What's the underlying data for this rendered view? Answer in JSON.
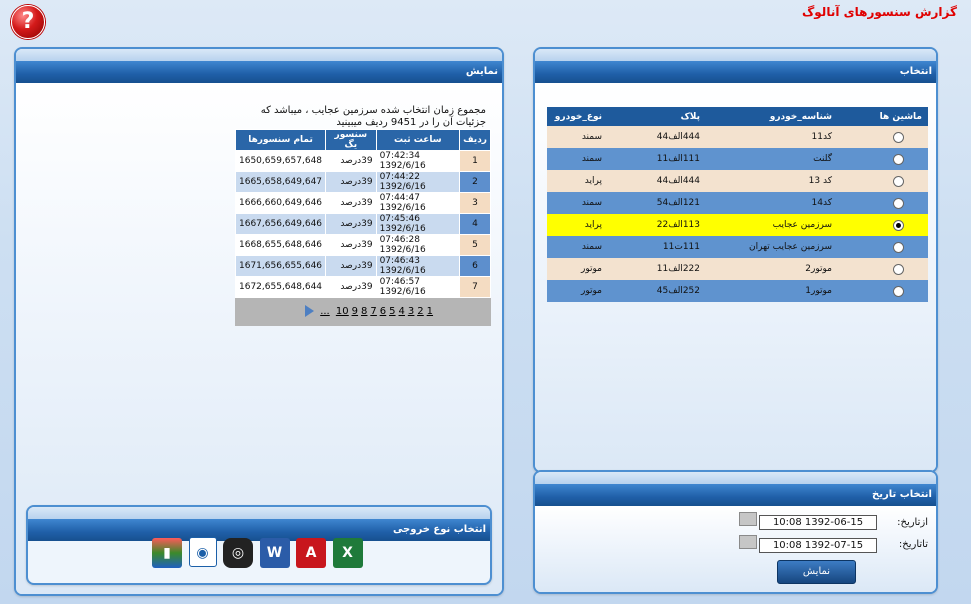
{
  "page": {
    "title": "گزارش سنسورهای آنالوگ"
  },
  "help": {
    "label": "?"
  },
  "selection": {
    "title": "انتخاب",
    "headers": [
      "ماشین ها",
      "شناسه_خودرو",
      "پلاک",
      "نوع_خودرو"
    ],
    "rows": [
      {
        "name": "کد11",
        "plate": "444الف44",
        "type": "سمند",
        "selected": false
      },
      {
        "name": "گلنت",
        "plate": "111الف11",
        "type": "سمند",
        "selected": false
      },
      {
        "name": "کد 13",
        "plate": "444الف44",
        "type": "پراید",
        "selected": false
      },
      {
        "name": "کد14",
        "plate": "121الف54",
        "type": "سمند",
        "selected": false
      },
      {
        "name": "سرزمین عجایب",
        "plate": "113الف22",
        "type": "پراید",
        "selected": true
      },
      {
        "name": "سرزمین عجایب تهران",
        "plate": "111ت11",
        "type": "سمند",
        "selected": false
      },
      {
        "name": "موتور2",
        "plate": "222الف11",
        "type": "موتور",
        "selected": false
      },
      {
        "name": "موتور1",
        "plate": "252الف45",
        "type": "موتور",
        "selected": false
      }
    ]
  },
  "date_select": {
    "title": "انتخاب تاریخ",
    "from_label": "ازتاریخ:",
    "from_value": "10:08 1392-06-15",
    "to_label": "تاتاریخ:",
    "to_value": "10:08 1392-07-15",
    "show_button": "نمایش"
  },
  "display": {
    "title": "نمایش",
    "summary_line1": "مجموع زمان انتخاب شده سرزمین عجایب ، میباشد که",
    "summary_line2": "جزئیات آن را در 9451 ردیف میبینید",
    "headers": [
      "ردیف",
      "ساعت ثبت",
      "سنسور یگ",
      "تمام سنسورها"
    ],
    "rows": [
      {
        "n": "1",
        "time": "07:42:34 1392/6/16",
        "sensor": "39درصد",
        "all": "1650,659,657,648"
      },
      {
        "n": "2",
        "time": "07:44:22 1392/6/16",
        "sensor": "39درصد",
        "all": "1665,658,649,647"
      },
      {
        "n": "3",
        "time": "07:44:47 1392/6/16",
        "sensor": "39درصد",
        "all": "1666,660,649,646"
      },
      {
        "n": "4",
        "time": "07:45:46 1392/6/16",
        "sensor": "39درصد",
        "all": "1667,656,649,646"
      },
      {
        "n": "5",
        "time": "07:46:28 1392/6/16",
        "sensor": "39درصد",
        "all": "1668,655,648,646"
      },
      {
        "n": "6",
        "time": "07:46:43 1392/6/16",
        "sensor": "39درصد",
        "all": "1671,656,655,646"
      },
      {
        "n": "7",
        "time": "07:46:57 1392/6/16",
        "sensor": "39درصد",
        "all": "1672,655,648,644"
      }
    ],
    "pager": {
      "ellipsis": "...",
      "pages": [
        "10",
        "9",
        "8",
        "7",
        "6",
        "5",
        "4",
        "3",
        "2",
        "1"
      ]
    }
  },
  "export": {
    "title": "انتخاب نوع خروجی",
    "icons": [
      "chart-icon",
      "browser-icon",
      "camera-icon",
      "word-icon",
      "pdf-icon",
      "excel-icon"
    ],
    "colors": {
      "excel": "#1f7a3a",
      "pdf": "#c8161d",
      "word": "#2b5ca8"
    }
  },
  "colors": {
    "header_blue": "#1e5a9c",
    "row_light": "#f3e2cf",
    "row_dark": "#5f93cf",
    "row_selected": "#ffff00",
    "title_red": "#e00000"
  }
}
